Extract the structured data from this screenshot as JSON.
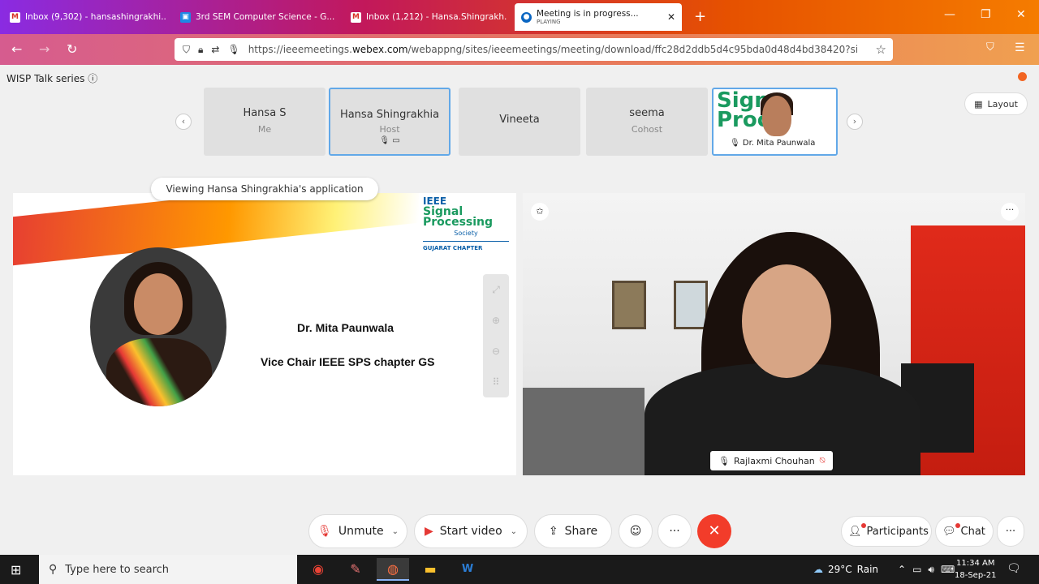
{
  "browser": {
    "tabs": [
      {
        "label": "Inbox (9,302) - hansashingrakhi...",
        "favicon": "gmail-icon",
        "active": false
      },
      {
        "label": "3rd SEM Computer Science - G...",
        "favicon": "classroom-icon",
        "active": false
      },
      {
        "label": "Inbox (1,212) - Hansa.Shingrakh...",
        "favicon": "gmail-icon",
        "active": false
      },
      {
        "label": "Meeting is in progress...",
        "sublabel": "PLAYING",
        "favicon": "webex-icon",
        "active": true
      }
    ],
    "url_prefix": "https://ieeemeetings.",
    "url_domain": "webex.com",
    "url_rest": "/webappng/sites/ieeemeetings/meeting/download/ffc28d2ddb5d4c95bda0d48d4bd38420?siteurl="
  },
  "meeting": {
    "title": "WISP Talk series",
    "layout_label": "Layout",
    "participants": [
      {
        "name": "Hansa S",
        "role": "Me"
      },
      {
        "name": "Hansa Shingrakhia",
        "role": "Host"
      },
      {
        "name": "Vineeta",
        "role": ""
      },
      {
        "name": "seema",
        "role": "Cohost"
      },
      {
        "name": "Dr. Mita Paunwala",
        "role": ""
      }
    ],
    "sharing": {
      "banner": "Viewing Hansa Shingrakhia's application",
      "slide_logo_line1": "IEEE",
      "slide_logo_line2": "Signal",
      "slide_logo_line3": "Processing",
      "slide_logo_line4": "Society",
      "slide_logo_line5": "GUJARAT CHAPTER",
      "slide_name": "Dr. Mita Paunwala",
      "slide_title": "Vice Chair IEEE SPS chapter GS"
    },
    "active_video": {
      "name": "Rajlaxmi Chouhan"
    },
    "controls": {
      "unmute": "Unmute",
      "start_video": "Start video",
      "share": "Share",
      "participants": "Participants",
      "chat": "Chat"
    }
  },
  "taskbar": {
    "search_placeholder": "Type here to search",
    "weather_temp": "29°C",
    "weather_desc": "Rain",
    "time": "11:34 AM",
    "date": "18-Sep-21"
  },
  "colors": {
    "end_call": "#f23c2a",
    "active_border": "#62a8e8",
    "notification": "#f26522"
  }
}
